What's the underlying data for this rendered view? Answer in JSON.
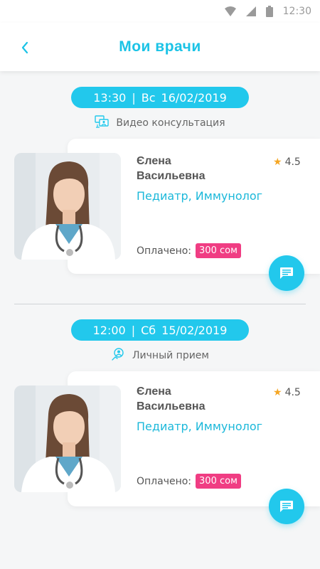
{
  "status_bar": {
    "time": "12:30"
  },
  "header": {
    "title": "Мои врачи"
  },
  "appointments": [
    {
      "time": "13:30",
      "day": "Вс",
      "date": "16/02/2019",
      "type_label": "Видео консультация",
      "type_icon": "video-consult-icon",
      "doctor": {
        "first_name": "Єлена",
        "last_name": "Васильевна",
        "rating": "4.5",
        "specialty": "Педиатр, Иммунолог",
        "paid_label": "Оплачено:",
        "price": "300 сом"
      }
    },
    {
      "time": "12:00",
      "day": "Сб",
      "date": "15/02/2019",
      "type_label": "Личный прием",
      "type_icon": "in-person-icon",
      "doctor": {
        "first_name": "Єлена",
        "last_name": "Васильевна",
        "rating": "4.5",
        "specialty": "Педиатр, Иммунолог",
        "paid_label": "Оплачено:",
        "price": "300 сом"
      }
    }
  ],
  "colors": {
    "accent": "#22c8ec",
    "price_badge": "#f03d83",
    "star": "#f5a623"
  }
}
